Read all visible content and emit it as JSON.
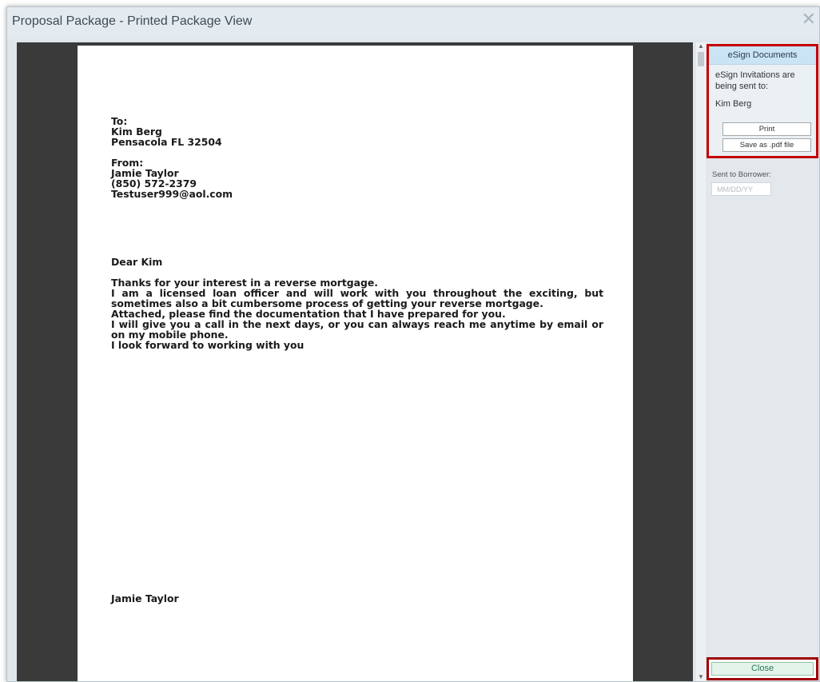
{
  "window": {
    "title": "Proposal Package - Printed Package View",
    "close_glyph": "✕"
  },
  "letter": {
    "to_label": "To:",
    "to_name": "Kim Berg",
    "to_address": "Pensacola FL 32504",
    "from_label": "From:",
    "from_name": "Jamie Taylor",
    "from_phone": "(850) 572-2379",
    "from_email": "Testuser999@aol.com",
    "salutation": "Dear Kim",
    "body": [
      "Thanks for your interest in a reverse mortgage.",
      "I am a licensed loan officer and will work with you throughout the exciting, but sometimes also a bit cumbersome process of getting your reverse mortgage.",
      "Attached, please find the documentation that I have prepared for you.",
      "I will give you a call in the next days, or you can always reach me anytime by email or on my mobile phone.",
      "I look forward to working with you"
    ],
    "signature": "Jamie Taylor"
  },
  "sidebar": {
    "esign_header": "eSign Documents",
    "esign_text": "eSign Invitations are being sent to:",
    "recipient": "Kim Berg",
    "print_label": "Print",
    "save_pdf_label": "Save as .pdf file",
    "sent_label": "Sent to Borrower:",
    "date_placeholder": "MM/DD/YY",
    "close_label": "Close"
  },
  "colors": {
    "highlight_border": "#c40000",
    "header_bg": "#cbe4f5",
    "close_text": "#2e7a55"
  },
  "icons": {
    "close": "close-icon",
    "scroll_up": "chevron-up-icon",
    "scroll_down": "chevron-down-icon"
  }
}
